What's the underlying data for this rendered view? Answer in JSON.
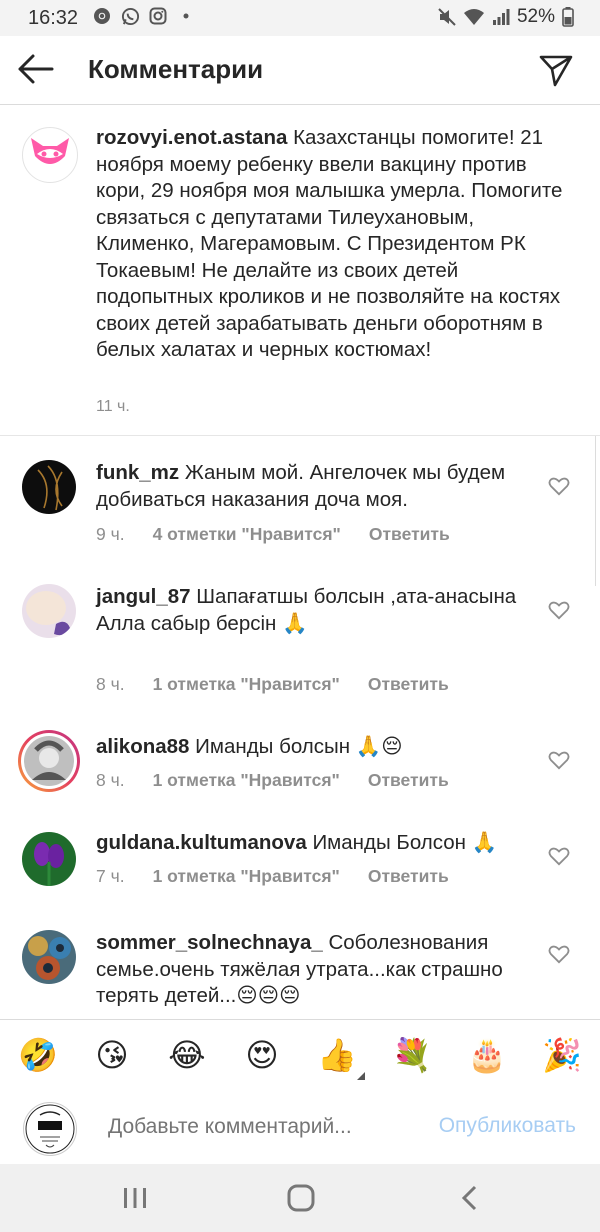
{
  "status_bar": {
    "time": "16:32",
    "battery": "52%",
    "left_icons": [
      "chrome-icon",
      "whatsapp-icon",
      "instagram-icon",
      "dot-icon"
    ],
    "right_icons": [
      "mute-icon",
      "wifi-icon",
      "signal-icon",
      "battery-icon"
    ]
  },
  "header": {
    "title": "Комментарии"
  },
  "caption": {
    "username": "rozovyi.enot.astana",
    "text": "Казахстанцы помогите! 21 ноября моему ребенку ввели вакцину против кори, 29 ноября моя малышка умерла. Помогите связаться с депутатами Тилеухановым, Клименко, Магерамовым. С Президентом РК Токаевым! Не делайте из своих детей подопытных кроликов и не позволяйте на костях своих детей зарабатывать деньги оборотням в белых халатах и черных костюмах!",
    "time": "11 ч."
  },
  "comments": [
    {
      "username": "funk_mz",
      "text": "Жаным мой. Ангелочек мы будем добиваться наказания доча моя.",
      "time": "9 ч.",
      "likes": "4 отметки \"Нравится\"",
      "reply": "Ответить"
    },
    {
      "username": "jangul_87",
      "text": "Шапағатшы болсын ,ата-анасына Алла сабыр берсін 🙏",
      "time": "8 ч.",
      "likes": "1 отметка \"Нравится\"",
      "reply": "Ответить"
    },
    {
      "username": "alikona88",
      "text": "Иманды болсын 🙏😔",
      "time": "8 ч.",
      "likes": "1 отметка \"Нравится\"",
      "reply": "Ответить"
    },
    {
      "username": "guldana.kultumanova",
      "text": "Иманды Болсон 🙏",
      "time": "7 ч.",
      "likes": "1 отметка \"Нравится\"",
      "reply": "Ответить"
    },
    {
      "username": "sommer_solnechnaya_",
      "text": "Соболезнования семье.очень тяжёлая утрата...как страшно терять детей...😔😔😔"
    }
  ],
  "emoji_bar": [
    "🤣",
    "😘",
    "😂",
    "😍",
    "👍",
    "💐",
    "🎂",
    "🎉"
  ],
  "input": {
    "placeholder": "Добавьте комментарий...",
    "publish": "Опубликовать"
  },
  "colors": {
    "accent_disabled": "#a7cdf3",
    "secondary_text": "#8e8e8e",
    "primary_text": "#262626"
  }
}
